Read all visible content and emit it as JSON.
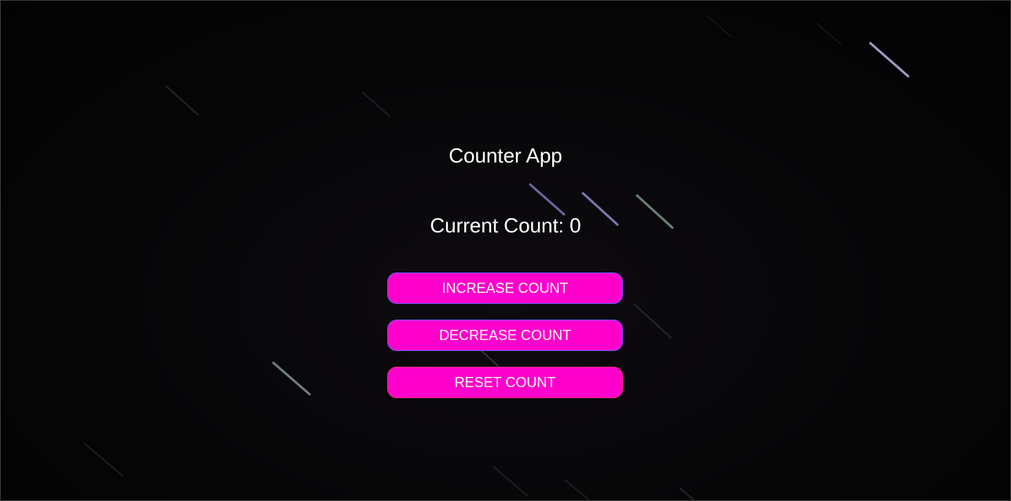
{
  "app": {
    "title": "Counter App",
    "count_label": "Current Count:",
    "count_value": "0"
  },
  "buttons": {
    "increase_label": "INCREASE COUNT",
    "decrease_label": "DECREASE COUNT",
    "reset_label": "RESET COUNT"
  },
  "colors": {
    "button_fill": "#ff00cc",
    "button_text": "#ffffff",
    "button_border_increase": "#6a5cff",
    "button_border_decrease": "#6a5cff",
    "button_border_reset": "#ff2a8a",
    "text": "#ffffff",
    "background": "#050506"
  },
  "background": {
    "description_icon": "star-trails-background"
  }
}
